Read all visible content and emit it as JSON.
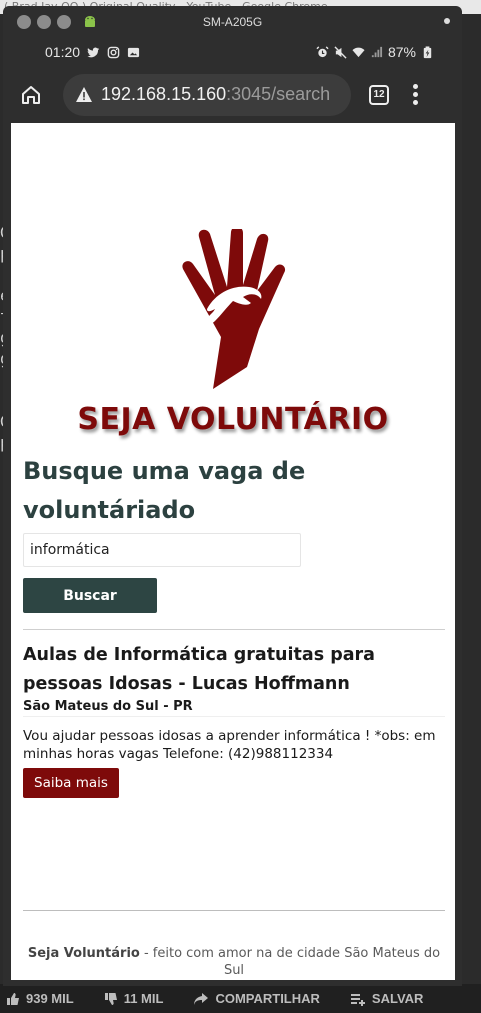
{
  "background": {
    "top_text": "( Brad Jay OQ ) Original Quality - YouTube - Google Chrome",
    "left_text_lines": [
      "Ge",
      "p",
      "",
      "",
      "ev",
      "t",
      "g",
      "g",
      "",
      "",
      "",
      "Ge",
      "p"
    ],
    "bottom_bar": {
      "likes": "939 MIL",
      "dislikes": "11 MIL",
      "share": "COMPARTILHAR",
      "save": "SALVAR"
    }
  },
  "window": {
    "title": "SM-A205G"
  },
  "statusbar": {
    "time": "01:20",
    "battery": "87%"
  },
  "browser": {
    "url_host": "192.168.15.160",
    "url_path": ":3045/search",
    "tab_count": "12"
  },
  "page": {
    "brand": "SEJA VOLUNTÁRIO",
    "search_title": "Busque uma vaga de voluntáriado",
    "search_value": "informática",
    "search_button": "Buscar",
    "result": {
      "title": "Aulas de Informática gratuitas para pessoas Idosas - Lucas Hoffmann",
      "location": "São Mateus do Sul - PR",
      "description": "Vou ajudar pessoas idosas a aprender informática ! *obs: em minhas horas vagas Telefone: (42)988112334",
      "cta": "Saiba mais"
    },
    "footer": {
      "brand": "Seja Voluntário",
      "text": " - feito com amor na de cidade São Mateus do Sul"
    }
  },
  "colors": {
    "brand_red": "#7e0a0a",
    "dark_teal": "#2d4543"
  }
}
